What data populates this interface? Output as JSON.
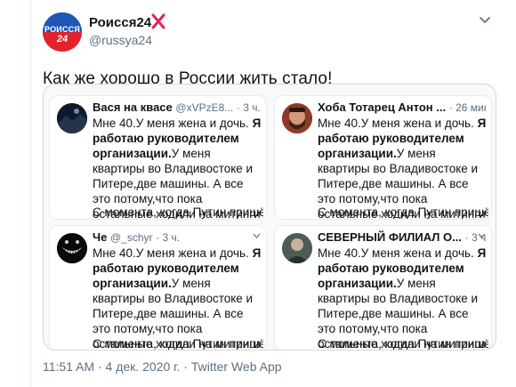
{
  "author": {
    "name": "Роисся24",
    "handle": "@russya24",
    "avatar_text": "РОИССЯ",
    "avatar_number": "24",
    "badge_color": "#e0245e"
  },
  "tweet": {
    "text": "Как же хорошо в России жить стало!",
    "timestamp": "11:51 AM · 4 дек. 2020 г. · Twitter Web App"
  },
  "cards": [
    {
      "name": "Вася на квасе",
      "handle": "@xVPzE8...",
      "time": "· 3 ч.",
      "avatar_icon": "dark-landscape-avatar"
    },
    {
      "name": "Хоба Тотарец Антон ...",
      "handle": "",
      "time": "· 26 мин.",
      "avatar_icon": "bearded-man-avatar"
    },
    {
      "name": "Че",
      "handle": "@_schyr",
      "time": "· 3 ч.",
      "avatar_icon": "cheshire-grin-avatar"
    },
    {
      "name": "СЕВЕРНЫЙ ФИЛИАЛ О...",
      "handle": "",
      "time": "· 3 ч.",
      "avatar_icon": "man-portrait-avatar"
    }
  ],
  "copypasta": {
    "line1": "Мне 40.У меня жена и дочь.",
    "bold1": "Я работаю руководителем организации.",
    "line2": "У меня квартиры во Владивостоке и Питере,две машины. А все это потому,что пока остальные ходили на митинги я учился и",
    "cut_line": "С момента, когда Путин пришёл к"
  },
  "colors": {
    "accent": "#1da1f2",
    "redaction": "#e4141b",
    "secondary_text": "#5b7083"
  }
}
